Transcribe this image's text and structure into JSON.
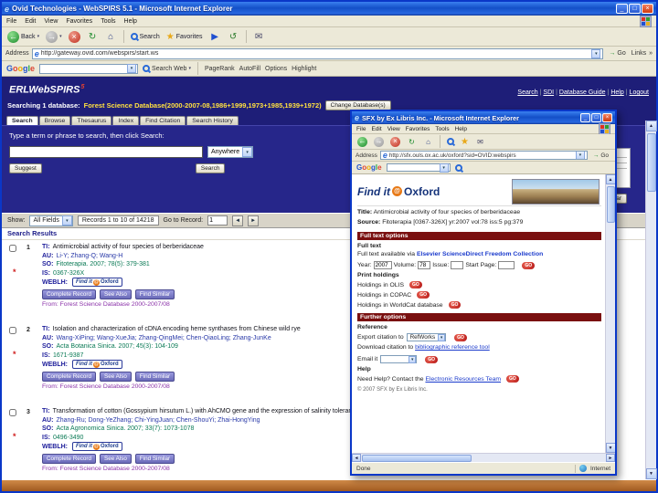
{
  "main_window": {
    "title": "Ovid Technologies - WebSPIRS 5.1 - Microsoft Internet Explorer",
    "menus": [
      "File",
      "Edit",
      "View",
      "Favorites",
      "Tools",
      "Help"
    ],
    "toolbar": {
      "back": "Back",
      "search": "Search",
      "favorites": "Favorites"
    },
    "address": {
      "label": "Address",
      "url": "http://gateway.ovid.com/webspirs/start.ws",
      "go": "Go",
      "links": "Links"
    },
    "google": {
      "letters": [
        "G",
        "o",
        "o",
        "g",
        "l",
        "e"
      ],
      "search_web": "Search Web",
      "buttons": [
        "PageRank",
        "AutoFill",
        "Options",
        "Highlight"
      ]
    }
  },
  "webspirs": {
    "logo": {
      "erl": "ERL",
      "web": "WebSPIRS",
      "ver": "5"
    },
    "nav_links": [
      "Search",
      "SDI",
      "Database Guide",
      "Help",
      "Logout"
    ],
    "searching_prefix": "Searching 1 database:",
    "database_name": "Forest Science Database(2000-2007-08,1986+1999,1973+1985,1939+1972)",
    "change_db_button": "Change Database(s)",
    "tabs": [
      "Search",
      "Browse",
      "Thesaurus",
      "Index",
      "Find Citation",
      "Search History"
    ],
    "search_instruction": "Type a term or phrase to search, then click Search:",
    "search_value": "",
    "anywhere": "Anywhere",
    "search_button": "Search",
    "suggest_button": "Suggest",
    "clear_button": "Clear",
    "show_label": "Show:",
    "show_value": "All Fields",
    "records_info": "Records 1 to 10 of 14218",
    "goto_label": "Go to Record:",
    "goto_value": "1",
    "results_header": "Search Results",
    "field_labels": {
      "ti": "TI:",
      "au": "AU:",
      "so": "SO:",
      "is": "IS:",
      "weblh": "WEBLH:"
    },
    "findit": {
      "find": "Find it",
      "at": "@",
      "oxford": "Oxford"
    },
    "actions": [
      "Complete Record",
      "See Also",
      "Find Similar"
    ],
    "record_source": "From: Forest Science Database 2000-2007/08"
  },
  "results": [
    {
      "num": "1",
      "ti": "Antimicrobial activity of four species of berberidaceae",
      "au": "Li-Y; Zhang-Q; Wang-H",
      "so": "Fitoterapia. 2007; 78(5): 379-381",
      "is": "0367-326X"
    },
    {
      "num": "2",
      "ti": "Isolation and characterization of cDNA encoding heme synthases from Chinese wild rye",
      "au": "Wang-XiPing; Wang-XueJia; Zhang-QingMei; Chen-QiaoLing; Zhang-JunKe",
      "so": "Acta Botanica Sinica. 2007; 45(3): 104-109",
      "is": "1671-9387"
    },
    {
      "num": "3",
      "ti": "Transformation of cotton (Gossypium hirsutum L.) with AhCMO gene and the expression of salinity tolerance",
      "au": "Zhang-Ru; Dong-YeZhang; Chi-YingJuan; Chen-ShouYi; Zhai-HongYing",
      "so": "Acta Agronomica Sinica. 2007; 33(7): 1073-1078",
      "is": "0496-3490"
    }
  ],
  "sfx": {
    "title": "SFX by Ex Libris Inc. - Microsoft Internet Explorer",
    "menus": [
      "File",
      "Edit",
      "View",
      "Favorites",
      "Tools",
      "Help"
    ],
    "address": {
      "label": "Address",
      "url": "http://sfx.ouls.ox.ac.uk/oxford?sid=OVID:webspirs",
      "go": "Go"
    },
    "logo": {
      "find": "Find it",
      "at": "@",
      "oxford": "Oxford"
    },
    "title_label": "Title:",
    "title_value": "Antimicrobial activity of four species of berberidaceae",
    "source_label": "Source:",
    "source_value": "Fitoterapia [0367-326X] yr:2007 vol:78 iss:5 pg:379",
    "full_text_options": "Full text options",
    "full_text": "Full text",
    "fulltext_line_prefix": "Full text available via",
    "fulltext_line_link": "Elsevier ScienceDirect Freedom Collection",
    "year_label": "Year:",
    "year_value": "2007",
    "volume_label": "Volume:",
    "volume_value": "78",
    "issue_label": "Issue:",
    "issue_value": "",
    "startpage_label": "Start Page:",
    "startpage_value": "",
    "go": "GO",
    "print_holdings": "Print holdings",
    "holdings": [
      "Holdings in OLIS",
      "Holdings in COPAC",
      "Holdings in WorldCat database"
    ],
    "further_options": "Further options",
    "reference": "Reference",
    "export_label": "Export citation to",
    "export_value": "RefWorks",
    "download_prefix": "Download citation to",
    "download_link": "bibliographic reference tool",
    "email_label": "Email it",
    "help": "Help",
    "help_prefix": "Need Help? Contact the",
    "help_link": "Electronic Resources Team",
    "copyright": "© 2007 SFX by Ex Libris Inc.",
    "status": "Done",
    "zone": "Internet"
  }
}
